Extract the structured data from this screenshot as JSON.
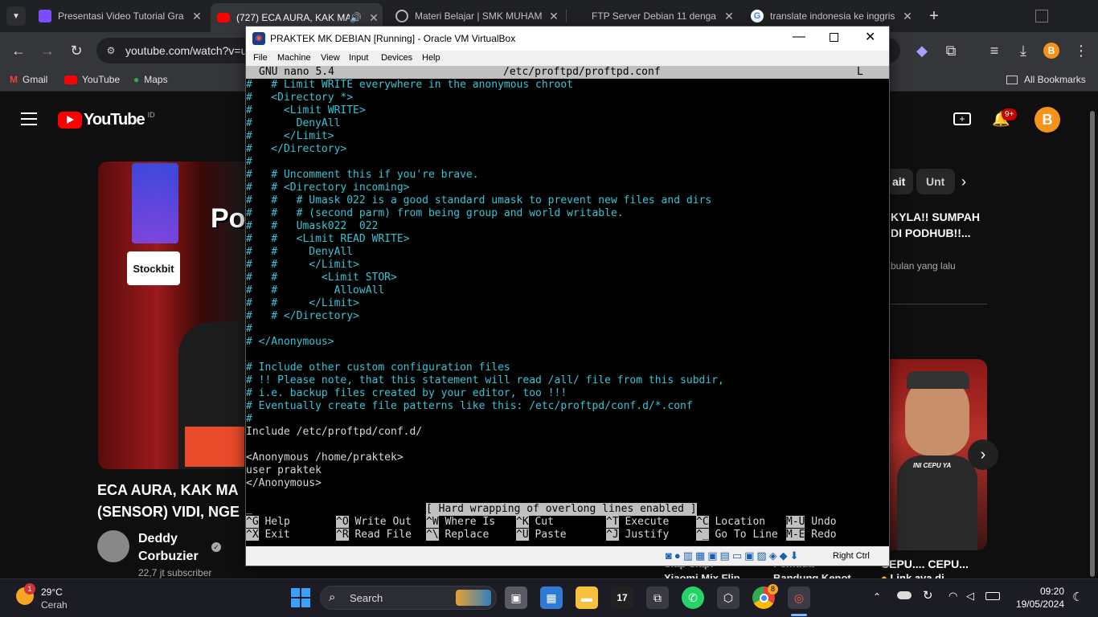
{
  "browser": {
    "tabs": [
      {
        "title": "Presentasi Video Tutorial Gra",
        "close": "✕"
      },
      {
        "title": "(727) ECA AURA, KAK MA",
        "close": "✕"
      },
      {
        "title": "Materi Belajar | SMK MUHAM",
        "close": "✕"
      },
      {
        "title": "FTP Server Debian 11 denga",
        "close": "✕"
      },
      {
        "title": "translate indonesia ke inggris",
        "close": "✕"
      }
    ],
    "new_tab": "+",
    "url": "youtube.com/watch?v=u",
    "bookmarks": [
      "Gmail",
      "YouTube",
      "Maps"
    ],
    "all_bookmarks": "All Bookmarks",
    "extension_letter": "B"
  },
  "youtube": {
    "logo": "YouTube",
    "region": "ID",
    "notif_badge": "9+",
    "avatar_letter": "B",
    "chip_1": "ait",
    "chip_2": "Unt",
    "video_title_1": "ECA AURA, KAK MA",
    "video_title_2": "(SENSOR) VIDI, NGE",
    "channel_name_1": "Deddy",
    "channel_name_2": "Corbuzier",
    "subscribers": "22,7 jt subscriber",
    "side_title_1": "KYLA!! SUMPAH",
    "side_title_2": "DI PODHUB!!...",
    "side_meta": "bulan yang lalu",
    "thumb_label": "Stockbit",
    "thumb_text": "Po",
    "rec_bottom_1": "Siap-siap!",
    "rec_bottom_2": "Xiaomi Mix Flip",
    "rec_bottom_3": "Pemuda",
    "rec_bottom_4": "Bandung Kenot",
    "rec_right_1": "CEPU.... CEPU...",
    "rec_right_2": "Link ava di",
    "thumb_caption": "INI CEPU YA"
  },
  "vm": {
    "title": "PRAKTEK MK DEBIAN [Running] - Oracle VM VirtualBox",
    "menu": [
      "File",
      "Machine",
      "View",
      "Input",
      "Devices",
      "Help"
    ],
    "host_key": "Right Ctrl"
  },
  "nano": {
    "version": "GNU nano 5.4",
    "filename": "/etc/proftpd/proftpd.conf",
    "flag": "L",
    "lines": [
      {
        "t": "#   # Limit WRITE everywhere in the anonymous chroot",
        "c": "cm"
      },
      {
        "t": "#   <Directory *>",
        "c": "cm"
      },
      {
        "t": "#     <Limit WRITE>",
        "c": "cm"
      },
      {
        "t": "#       DenyAll",
        "c": "cm"
      },
      {
        "t": "#     </Limit>",
        "c": "cm"
      },
      {
        "t": "#   </Directory>",
        "c": "cm"
      },
      {
        "t": "#",
        "c": "cm"
      },
      {
        "t": "#   # Uncomment this if you're brave.",
        "c": "cm"
      },
      {
        "t": "#   # <Directory incoming>",
        "c": "cm"
      },
      {
        "t": "#   #   # Umask 022 is a good standard umask to prevent new files and dirs",
        "c": "cm"
      },
      {
        "t": "#   #   # (second parm) from being group and world writable.",
        "c": "cm"
      },
      {
        "t": "#   #   Umask022  022",
        "c": "cm"
      },
      {
        "t": "#   #   <Limit READ WRITE>",
        "c": "cm"
      },
      {
        "t": "#   #     DenyAll",
        "c": "cm"
      },
      {
        "t": "#   #     </Limit>",
        "c": "cm"
      },
      {
        "t": "#   #       <Limit STOR>",
        "c": "cm"
      },
      {
        "t": "#   #         AllowAll",
        "c": "cm"
      },
      {
        "t": "#   #     </Limit>",
        "c": "cm"
      },
      {
        "t": "#   # </Directory>",
        "c": "cm"
      },
      {
        "t": "#",
        "c": "cm"
      },
      {
        "t": "# </Anonymous>",
        "c": "cm"
      },
      {
        "t": "",
        "c": "pl"
      },
      {
        "t": "# Include other custom configuration files",
        "c": "cm"
      },
      {
        "t": "# !! Please note, that this statement will read /all/ file from this subdir,",
        "c": "cm"
      },
      {
        "t": "# i.e. backup files created by your editor, too !!!",
        "c": "cm"
      },
      {
        "t": "# Eventually create file patterns like this: /etc/proftpd/conf.d/*.conf",
        "c": "cm"
      },
      {
        "t": "#",
        "c": "cm"
      },
      {
        "t": "Include /etc/proftpd/conf.d/",
        "c": "pl"
      },
      {
        "t": "",
        "c": "pl"
      },
      {
        "t": "<Anonymous /home/praktek>",
        "c": "pl"
      },
      {
        "t": "user praktek",
        "c": "pl"
      },
      {
        "t": "</Anonymous>",
        "c": "pl"
      },
      {
        "t": "",
        "c": "pl"
      },
      {
        "t": "_",
        "c": "pl"
      }
    ],
    "status_message": "[ Hard wrapping of overlong lines enabled ]",
    "shortcuts_row1": [
      {
        "key": "^G",
        "label": " Help"
      },
      {
        "key": "^O",
        "label": " Write Out"
      },
      {
        "key": "^W",
        "label": " Where Is"
      },
      {
        "key": "^K",
        "label": " Cut"
      },
      {
        "key": "^T",
        "label": " Execute"
      },
      {
        "key": "^C",
        "label": " Location"
      },
      {
        "key": "M-U",
        "label": " Undo"
      }
    ],
    "shortcuts_row2": [
      {
        "key": "^X",
        "label": " Exit"
      },
      {
        "key": "^R",
        "label": " Read File"
      },
      {
        "key": "^\\",
        "label": " Replace"
      },
      {
        "key": "^U",
        "label": " Paste"
      },
      {
        "key": "^J",
        "label": " Justify"
      },
      {
        "key": "^_",
        "label": " Go To Line"
      },
      {
        "key": "M-E",
        "label": " Redo"
      }
    ]
  },
  "taskbar": {
    "weather_temp": "29°C",
    "weather_desc": "Cerah",
    "weather_badge": "1",
    "search": "Search",
    "chrome_badge": "8",
    "time": "09:20",
    "date": "19/05/2024"
  }
}
